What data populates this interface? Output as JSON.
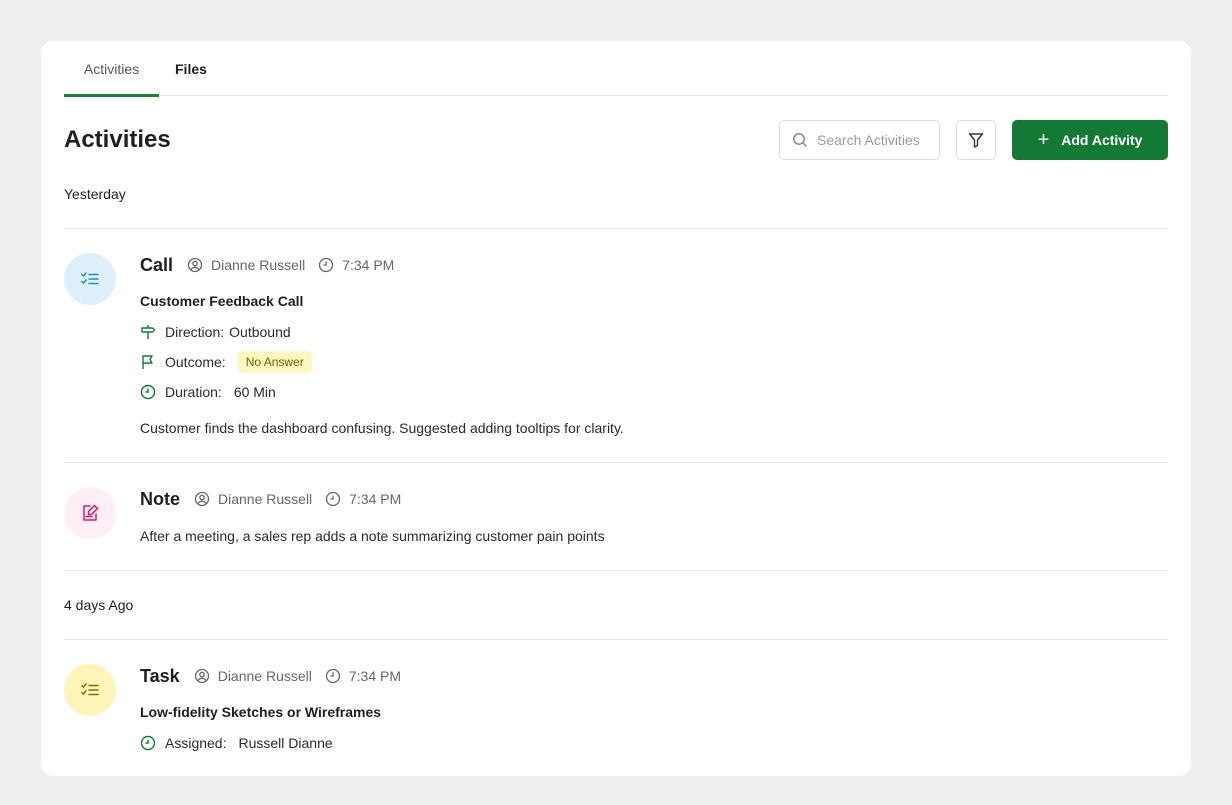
{
  "tabs": [
    {
      "label": "Activities",
      "active": true
    },
    {
      "label": "Files",
      "active": false
    }
  ],
  "header": {
    "title": "Activities",
    "search_placeholder": "Search Activities",
    "add_label": "Add Activity"
  },
  "colors": {
    "accent": "#137a36",
    "tab_underline": "#1b7f3b",
    "badge_bg": "#fdf7c0",
    "call_avatar": "#dff0fb",
    "note_avatar": "#fdeff5",
    "task_avatar": "#fdf5b8"
  },
  "groups": [
    {
      "label": "Yesterday",
      "activities": [
        {
          "type": "Call",
          "icon": "checklist-icon",
          "user": "Dianne Russell",
          "time": "7:34 PM",
          "title": "Customer Feedback Call",
          "direction_label": "Direction:",
          "direction_value": "Outbound",
          "outcome_label": "Outcome:",
          "outcome_value": "No Answer",
          "duration_label": "Duration:",
          "duration_value": "60 Min",
          "description": "Customer finds the dashboard confusing. Suggested adding tooltips for clarity."
        },
        {
          "type": "Note",
          "icon": "note-edit-icon",
          "user": "Dianne Russell",
          "time": "7:34 PM",
          "description": "After a meeting, a sales rep adds a note summarizing customer pain points"
        }
      ]
    },
    {
      "label": "4 days Ago",
      "activities": [
        {
          "type": "Task",
          "icon": "checklist-icon",
          "user": "Dianne Russell",
          "time": "7:34 PM",
          "title": "Low-fidelity Sketches or Wireframes",
          "assigned_label": "Assigned:",
          "assigned_value": "Russell Dianne"
        }
      ]
    }
  ]
}
